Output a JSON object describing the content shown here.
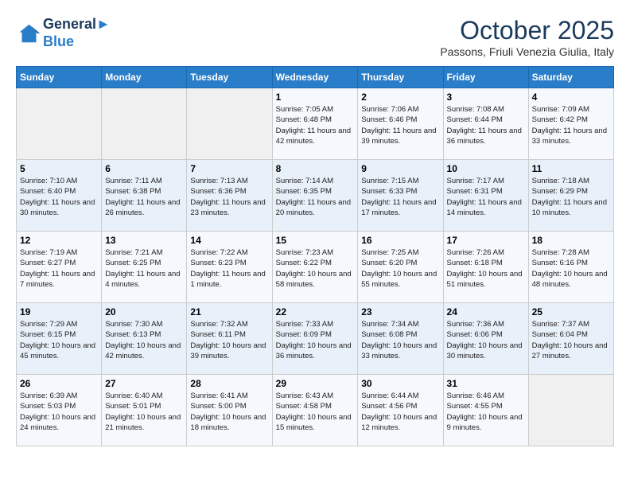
{
  "header": {
    "logo_line1": "General",
    "logo_line2": "Blue",
    "month": "October 2025",
    "location": "Passons, Friuli Venezia Giulia, Italy"
  },
  "days_of_week": [
    "Sunday",
    "Monday",
    "Tuesday",
    "Wednesday",
    "Thursday",
    "Friday",
    "Saturday"
  ],
  "weeks": [
    [
      {
        "day": "",
        "info": ""
      },
      {
        "day": "",
        "info": ""
      },
      {
        "day": "",
        "info": ""
      },
      {
        "day": "1",
        "info": "Sunrise: 7:05 AM\nSunset: 6:48 PM\nDaylight: 11 hours and 42 minutes."
      },
      {
        "day": "2",
        "info": "Sunrise: 7:06 AM\nSunset: 6:46 PM\nDaylight: 11 hours and 39 minutes."
      },
      {
        "day": "3",
        "info": "Sunrise: 7:08 AM\nSunset: 6:44 PM\nDaylight: 11 hours and 36 minutes."
      },
      {
        "day": "4",
        "info": "Sunrise: 7:09 AM\nSunset: 6:42 PM\nDaylight: 11 hours and 33 minutes."
      }
    ],
    [
      {
        "day": "5",
        "info": "Sunrise: 7:10 AM\nSunset: 6:40 PM\nDaylight: 11 hours and 30 minutes."
      },
      {
        "day": "6",
        "info": "Sunrise: 7:11 AM\nSunset: 6:38 PM\nDaylight: 11 hours and 26 minutes."
      },
      {
        "day": "7",
        "info": "Sunrise: 7:13 AM\nSunset: 6:36 PM\nDaylight: 11 hours and 23 minutes."
      },
      {
        "day": "8",
        "info": "Sunrise: 7:14 AM\nSunset: 6:35 PM\nDaylight: 11 hours and 20 minutes."
      },
      {
        "day": "9",
        "info": "Sunrise: 7:15 AM\nSunset: 6:33 PM\nDaylight: 11 hours and 17 minutes."
      },
      {
        "day": "10",
        "info": "Sunrise: 7:17 AM\nSunset: 6:31 PM\nDaylight: 11 hours and 14 minutes."
      },
      {
        "day": "11",
        "info": "Sunrise: 7:18 AM\nSunset: 6:29 PM\nDaylight: 11 hours and 10 minutes."
      }
    ],
    [
      {
        "day": "12",
        "info": "Sunrise: 7:19 AM\nSunset: 6:27 PM\nDaylight: 11 hours and 7 minutes."
      },
      {
        "day": "13",
        "info": "Sunrise: 7:21 AM\nSunset: 6:25 PM\nDaylight: 11 hours and 4 minutes."
      },
      {
        "day": "14",
        "info": "Sunrise: 7:22 AM\nSunset: 6:23 PM\nDaylight: 11 hours and 1 minute."
      },
      {
        "day": "15",
        "info": "Sunrise: 7:23 AM\nSunset: 6:22 PM\nDaylight: 10 hours and 58 minutes."
      },
      {
        "day": "16",
        "info": "Sunrise: 7:25 AM\nSunset: 6:20 PM\nDaylight: 10 hours and 55 minutes."
      },
      {
        "day": "17",
        "info": "Sunrise: 7:26 AM\nSunset: 6:18 PM\nDaylight: 10 hours and 51 minutes."
      },
      {
        "day": "18",
        "info": "Sunrise: 7:28 AM\nSunset: 6:16 PM\nDaylight: 10 hours and 48 minutes."
      }
    ],
    [
      {
        "day": "19",
        "info": "Sunrise: 7:29 AM\nSunset: 6:15 PM\nDaylight: 10 hours and 45 minutes."
      },
      {
        "day": "20",
        "info": "Sunrise: 7:30 AM\nSunset: 6:13 PM\nDaylight: 10 hours and 42 minutes."
      },
      {
        "day": "21",
        "info": "Sunrise: 7:32 AM\nSunset: 6:11 PM\nDaylight: 10 hours and 39 minutes."
      },
      {
        "day": "22",
        "info": "Sunrise: 7:33 AM\nSunset: 6:09 PM\nDaylight: 10 hours and 36 minutes."
      },
      {
        "day": "23",
        "info": "Sunrise: 7:34 AM\nSunset: 6:08 PM\nDaylight: 10 hours and 33 minutes."
      },
      {
        "day": "24",
        "info": "Sunrise: 7:36 AM\nSunset: 6:06 PM\nDaylight: 10 hours and 30 minutes."
      },
      {
        "day": "25",
        "info": "Sunrise: 7:37 AM\nSunset: 6:04 PM\nDaylight: 10 hours and 27 minutes."
      }
    ],
    [
      {
        "day": "26",
        "info": "Sunrise: 6:39 AM\nSunset: 5:03 PM\nDaylight: 10 hours and 24 minutes."
      },
      {
        "day": "27",
        "info": "Sunrise: 6:40 AM\nSunset: 5:01 PM\nDaylight: 10 hours and 21 minutes."
      },
      {
        "day": "28",
        "info": "Sunrise: 6:41 AM\nSunset: 5:00 PM\nDaylight: 10 hours and 18 minutes."
      },
      {
        "day": "29",
        "info": "Sunrise: 6:43 AM\nSunset: 4:58 PM\nDaylight: 10 hours and 15 minutes."
      },
      {
        "day": "30",
        "info": "Sunrise: 6:44 AM\nSunset: 4:56 PM\nDaylight: 10 hours and 12 minutes."
      },
      {
        "day": "31",
        "info": "Sunrise: 6:46 AM\nSunset: 4:55 PM\nDaylight: 10 hours and 9 minutes."
      },
      {
        "day": "",
        "info": ""
      }
    ]
  ]
}
